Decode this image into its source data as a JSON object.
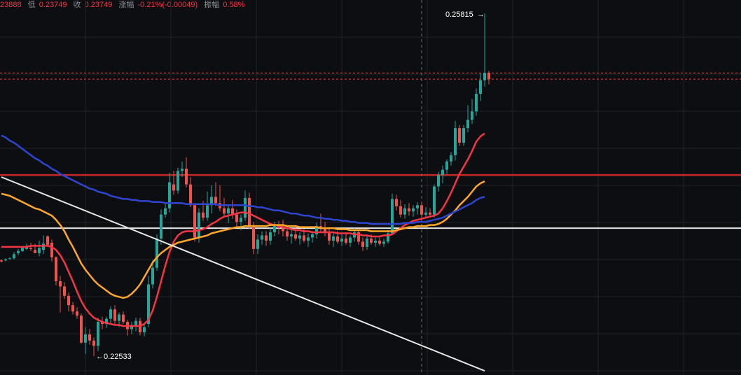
{
  "info_bar": {
    "high_value_fragment": "23888",
    "low_label": "低",
    "low_value": "0.23749",
    "close_label": "收",
    "close_value": "0.23749",
    "change_label": "涨幅",
    "change_value": "-0.21%(-0.00049)",
    "amplitude_label": "振幅",
    "amplitude_value": "0.58%"
  },
  "colors": {
    "background": "#0d0e11",
    "grid": "#1f2126",
    "up": "#26a69a",
    "down": "#ef5350",
    "ma_short": "#f23645",
    "ma_mid": "#ffa726",
    "ma_long": "#2f45d0",
    "horizontal_red": "#c62828",
    "trend_white": "#e6e6e6",
    "price_dash": "#ef5350",
    "crosshair": "#6b7078",
    "info_red": "#f23645"
  },
  "chart_data": {
    "type": "candlestick",
    "title": "",
    "ylim": [
      0.2235,
      0.2595
    ],
    "annotations": {
      "high_label": "0.25815",
      "high_value": 0.25815,
      "low_label": "0.22533",
      "low_value": 0.22533
    },
    "horizontal_lines": [
      {
        "name": "resistance",
        "value": 0.2427,
        "color": "red"
      },
      {
        "name": "support",
        "value": 0.2376,
        "color": "white"
      }
    ],
    "trend_line": {
      "from": {
        "index": 0,
        "value": 0.2425
      },
      "to": {
        "index": 115,
        "value": 0.2239
      }
    },
    "price_lines": [
      0.2525,
      0.2519
    ],
    "crosshair_index": 100,
    "candles": [
      [
        0.2345,
        0.2346,
        0.2343,
        0.2344
      ],
      [
        0.2345,
        0.2347,
        0.2344,
        0.2346
      ],
      [
        0.2347,
        0.2348,
        0.2346,
        0.2347
      ],
      [
        0.2347,
        0.2353,
        0.2346,
        0.2351
      ],
      [
        0.2352,
        0.2356,
        0.235,
        0.2354
      ],
      [
        0.2354,
        0.2358,
        0.2353,
        0.2357
      ],
      [
        0.2356,
        0.2361,
        0.2355,
        0.2359
      ],
      [
        0.2357,
        0.2362,
        0.2354,
        0.2356
      ],
      [
        0.2355,
        0.2361,
        0.2352,
        0.2352
      ],
      [
        0.2352,
        0.2364,
        0.2349,
        0.2357
      ],
      [
        0.2355,
        0.2369,
        0.2351,
        0.2361
      ],
      [
        0.2368,
        0.2369,
        0.2359,
        0.236
      ],
      [
        0.2362,
        0.2365,
        0.2344,
        0.2348
      ],
      [
        0.2348,
        0.2349,
        0.2321,
        0.2325
      ],
      [
        0.2325,
        0.233,
        0.2295,
        0.232
      ],
      [
        0.232,
        0.2324,
        0.2308,
        0.2311
      ],
      [
        0.2311,
        0.2314,
        0.2296,
        0.2302
      ],
      [
        0.2302,
        0.2305,
        0.2293,
        0.2296
      ],
      [
        0.2296,
        0.23,
        0.2289,
        0.2292
      ],
      [
        0.2292,
        0.2294,
        0.2265,
        0.2266
      ],
      [
        0.2266,
        0.2281,
        0.2255,
        0.2274
      ],
      [
        0.2274,
        0.2279,
        0.2264,
        0.2268
      ],
      [
        0.2268,
        0.2271,
        0.2253,
        0.2263
      ],
      [
        0.2263,
        0.229,
        0.2258,
        0.2286
      ],
      [
        0.2286,
        0.2291,
        0.2279,
        0.2284
      ],
      [
        0.2284,
        0.2291,
        0.228,
        0.2289
      ],
      [
        0.2289,
        0.2301,
        0.2285,
        0.2298
      ],
      [
        0.2298,
        0.2302,
        0.2284,
        0.2287
      ],
      [
        0.2287,
        0.2295,
        0.2281,
        0.2293
      ],
      [
        0.2293,
        0.2296,
        0.2284,
        0.2286
      ],
      [
        0.2286,
        0.2288,
        0.2273,
        0.2279
      ],
      [
        0.2279,
        0.2286,
        0.2274,
        0.2283
      ],
      [
        0.2283,
        0.229,
        0.2277,
        0.2287
      ],
      [
        0.2287,
        0.229,
        0.2273,
        0.2276
      ],
      [
        0.2276,
        0.2284,
        0.2272,
        0.2281
      ],
      [
        0.2284,
        0.233,
        0.2281,
        0.2322
      ],
      [
        0.2322,
        0.2345,
        0.2318,
        0.2338
      ],
      [
        0.2338,
        0.237,
        0.2335,
        0.2366
      ],
      [
        0.2366,
        0.2394,
        0.236,
        0.2389
      ],
      [
        0.2389,
        0.2401,
        0.2386,
        0.2395
      ],
      [
        0.2395,
        0.2429,
        0.2391,
        0.242
      ],
      [
        0.2418,
        0.2431,
        0.2408,
        0.2412
      ],
      [
        0.2412,
        0.2434,
        0.2409,
        0.2431
      ],
      [
        0.2431,
        0.244,
        0.2425,
        0.2433
      ],
      [
        0.2433,
        0.2444,
        0.2415,
        0.2418
      ],
      [
        0.2418,
        0.2425,
        0.2396,
        0.2398
      ],
      [
        0.2398,
        0.24,
        0.2363,
        0.2367
      ],
      [
        0.2367,
        0.2395,
        0.2362,
        0.2391
      ],
      [
        0.2391,
        0.2402,
        0.2383,
        0.2386
      ],
      [
        0.2386,
        0.2411,
        0.2383,
        0.2398
      ],
      [
        0.2398,
        0.2417,
        0.239,
        0.2406
      ],
      [
        0.2406,
        0.242,
        0.2397,
        0.24
      ],
      [
        0.24,
        0.2417,
        0.2392,
        0.2395
      ],
      [
        0.2395,
        0.2405,
        0.2387,
        0.239
      ],
      [
        0.239,
        0.2399,
        0.2381,
        0.2395
      ],
      [
        0.2395,
        0.2403,
        0.2385,
        0.2389
      ],
      [
        0.2389,
        0.2394,
        0.2378,
        0.2382
      ],
      [
        0.2382,
        0.2389,
        0.2374,
        0.2386
      ],
      [
        0.2386,
        0.2412,
        0.2383,
        0.2405
      ],
      [
        0.2405,
        0.241,
        0.2375,
        0.2378
      ],
      [
        0.2378,
        0.2382,
        0.2351,
        0.2356
      ],
      [
        0.2356,
        0.237,
        0.2351,
        0.2365
      ],
      [
        0.2365,
        0.2373,
        0.236,
        0.2369
      ],
      [
        0.2369,
        0.2373,
        0.2359,
        0.2364
      ],
      [
        0.2364,
        0.2376,
        0.236,
        0.2372
      ],
      [
        0.2372,
        0.2382,
        0.2368,
        0.2378
      ],
      [
        0.2378,
        0.2383,
        0.237,
        0.2376
      ],
      [
        0.2376,
        0.2384,
        0.2368,
        0.2373
      ],
      [
        0.2373,
        0.2379,
        0.2364,
        0.2368
      ],
      [
        0.2368,
        0.2374,
        0.2361,
        0.237
      ],
      [
        0.237,
        0.2376,
        0.2364,
        0.2366
      ],
      [
        0.2366,
        0.2372,
        0.236,
        0.2369
      ],
      [
        0.2369,
        0.2375,
        0.2362,
        0.2364
      ],
      [
        0.2364,
        0.2371,
        0.2358,
        0.2367
      ],
      [
        0.2367,
        0.2373,
        0.2362,
        0.237
      ],
      [
        0.237,
        0.2381,
        0.2366,
        0.2378
      ],
      [
        0.2378,
        0.239,
        0.2372,
        0.2376
      ],
      [
        0.2376,
        0.2382,
        0.2368,
        0.2372
      ],
      [
        0.2372,
        0.2377,
        0.236,
        0.2364
      ],
      [
        0.2364,
        0.2371,
        0.2358,
        0.2368
      ],
      [
        0.2368,
        0.2373,
        0.2361,
        0.2363
      ],
      [
        0.2363,
        0.237,
        0.2359,
        0.2366
      ],
      [
        0.2366,
        0.2372,
        0.236,
        0.2362
      ],
      [
        0.2362,
        0.2369,
        0.2358,
        0.2367
      ],
      [
        0.2367,
        0.2376,
        0.2363,
        0.2372
      ],
      [
        0.2372,
        0.2375,
        0.236,
        0.2363
      ],
      [
        0.2363,
        0.2367,
        0.2354,
        0.2358
      ],
      [
        0.2358,
        0.2368,
        0.2355,
        0.2366
      ],
      [
        0.2366,
        0.237,
        0.236,
        0.2362
      ],
      [
        0.2362,
        0.2367,
        0.2358,
        0.2364
      ],
      [
        0.2364,
        0.2367,
        0.2359,
        0.2361
      ],
      [
        0.2361,
        0.2366,
        0.2358,
        0.2363
      ],
      [
        0.2363,
        0.2374,
        0.2361,
        0.2371
      ],
      [
        0.2371,
        0.2409,
        0.2369,
        0.2404
      ],
      [
        0.2404,
        0.2408,
        0.2393,
        0.2397
      ],
      [
        0.2397,
        0.2403,
        0.2386,
        0.2389
      ],
      [
        0.2389,
        0.2399,
        0.2385,
        0.2395
      ],
      [
        0.2395,
        0.24,
        0.2388,
        0.2392
      ],
      [
        0.2392,
        0.2398,
        0.2387,
        0.2395
      ],
      [
        0.2395,
        0.2401,
        0.2389,
        0.2398
      ],
      [
        0.2398,
        0.2401,
        0.2386,
        0.2389
      ],
      [
        0.2389,
        0.2396,
        0.2386,
        0.2391
      ],
      [
        0.2391,
        0.2395,
        0.2386,
        0.2389
      ],
      [
        0.2389,
        0.2418,
        0.2386,
        0.2416
      ],
      [
        0.2416,
        0.243,
        0.2411,
        0.2427
      ],
      [
        0.2427,
        0.2436,
        0.2419,
        0.2432
      ],
      [
        0.2432,
        0.2442,
        0.2428,
        0.244
      ],
      [
        0.244,
        0.2449,
        0.2436,
        0.2446
      ],
      [
        0.2446,
        0.2479,
        0.2441,
        0.2472
      ],
      [
        0.2472,
        0.2475,
        0.2455,
        0.2458
      ],
      [
        0.2458,
        0.2475,
        0.2455,
        0.2472
      ],
      [
        0.2472,
        0.2494,
        0.2468,
        0.248
      ],
      [
        0.248,
        0.25,
        0.2476,
        0.2488
      ],
      [
        0.2488,
        0.251,
        0.2484,
        0.2505
      ],
      [
        0.2505,
        0.2525,
        0.2498,
        0.2518
      ],
      [
        0.2518,
        0.2582,
        0.2512,
        0.2525
      ],
      [
        0.2525,
        0.2527,
        0.2514,
        0.2519
      ]
    ],
    "moving_averages": [
      {
        "name": "",
        "color": "ma_short",
        "values": [
          0.2358,
          0.2358,
          0.2358,
          0.2358,
          0.2358,
          0.2358,
          0.2358,
          0.2359,
          0.2359,
          0.2359,
          0.2359,
          0.2359,
          0.2358,
          0.2355,
          0.235,
          0.2343,
          0.2334,
          0.2325,
          0.2315,
          0.2306,
          0.2299,
          0.2294,
          0.229,
          0.2288,
          0.2286,
          0.2285,
          0.2284,
          0.2283,
          0.2283,
          0.2282,
          0.2282,
          0.2282,
          0.2282,
          0.2282,
          0.2284,
          0.2288,
          0.2297,
          0.231,
          0.2325,
          0.234,
          0.2353,
          0.2363,
          0.2369,
          0.2372,
          0.2373,
          0.2373,
          0.2373,
          0.2374,
          0.2375,
          0.2377,
          0.238,
          0.2382,
          0.2385,
          0.2387,
          0.2388,
          0.2389,
          0.239,
          0.2391,
          0.2391,
          0.239,
          0.2388,
          0.2386,
          0.2384,
          0.2382,
          0.238,
          0.2379,
          0.2378,
          0.2377,
          0.2376,
          0.2375,
          0.2374,
          0.2374,
          0.2373,
          0.2373,
          0.2372,
          0.2372,
          0.2372,
          0.2372,
          0.2372,
          0.2372,
          0.2371,
          0.2371,
          0.2371,
          0.2371,
          0.237,
          0.237,
          0.2369,
          0.2369,
          0.2368,
          0.2368,
          0.2368,
          0.2369,
          0.2369,
          0.237,
          0.2373,
          0.2376,
          0.2379,
          0.2381,
          0.2383,
          0.2384,
          0.2385,
          0.2386,
          0.2387,
          0.2388,
          0.239,
          0.2395,
          0.2402,
          0.241,
          0.2419,
          0.2428,
          0.2435,
          0.2442,
          0.245,
          0.2459,
          0.2464,
          0.2467
        ]
      },
      {
        "name": "",
        "color": "ma_mid",
        "values": [
          0.2409,
          0.2408,
          0.2407,
          0.2405,
          0.2403,
          0.2401,
          0.2399,
          0.2397,
          0.2395,
          0.2394,
          0.2392,
          0.239,
          0.2388,
          0.2384,
          0.2379,
          0.2373,
          0.2365,
          0.2358,
          0.235,
          0.2342,
          0.2336,
          0.2331,
          0.2326,
          0.2322,
          0.2319,
          0.2316,
          0.2313,
          0.2311,
          0.231,
          0.2309,
          0.231,
          0.2313,
          0.2317,
          0.2322,
          0.2329,
          0.2336,
          0.2343,
          0.2348,
          0.2352,
          0.2355,
          0.2358,
          0.236,
          0.2362,
          0.2363,
          0.2364,
          0.2365,
          0.2366,
          0.2367,
          0.2368,
          0.2369,
          0.2371,
          0.2372,
          0.2373,
          0.2374,
          0.2375,
          0.2376,
          0.2377,
          0.2377,
          0.2378,
          0.2378,
          0.2378,
          0.2378,
          0.2378,
          0.2378,
          0.2379,
          0.2379,
          0.2379,
          0.2379,
          0.2378,
          0.2378,
          0.2378,
          0.2377,
          0.2377,
          0.2377,
          0.2377,
          0.2377,
          0.2376,
          0.2376,
          0.2376,
          0.2376,
          0.2375,
          0.2375,
          0.2375,
          0.2374,
          0.2374,
          0.2374,
          0.2374,
          0.2374,
          0.2373,
          0.2373,
          0.2373,
          0.2373,
          0.2373,
          0.2373,
          0.2374,
          0.2375,
          0.2376,
          0.2377,
          0.2377,
          0.2378,
          0.2378,
          0.2378,
          0.2379,
          0.2379,
          0.238,
          0.2382,
          0.2385,
          0.2389,
          0.2393,
          0.2398,
          0.2402,
          0.2406,
          0.2411,
          0.2416,
          0.2419,
          0.2421
        ]
      },
      {
        "name": "",
        "color": "ma_long",
        "values": [
          0.2465,
          0.2463,
          0.246,
          0.2458,
          0.2455,
          0.2452,
          0.2449,
          0.2446,
          0.2443,
          0.2441,
          0.2438,
          0.2436,
          0.2433,
          0.2431,
          0.2428,
          0.2426,
          0.2424,
          0.2422,
          0.242,
          0.2418,
          0.2416,
          0.2414,
          0.2413,
          0.2411,
          0.241,
          0.2409,
          0.2407,
          0.2406,
          0.2405,
          0.2404,
          0.2404,
          0.2403,
          0.2403,
          0.2402,
          0.2402,
          0.2402,
          0.2401,
          0.2401,
          0.2401,
          0.24,
          0.24,
          0.24,
          0.24,
          0.24,
          0.2399,
          0.2399,
          0.2399,
          0.2399,
          0.2399,
          0.2399,
          0.2399,
          0.2399,
          0.2398,
          0.2398,
          0.2398,
          0.2398,
          0.2398,
          0.2398,
          0.2398,
          0.2397,
          0.2397,
          0.2396,
          0.2396,
          0.2395,
          0.2394,
          0.2393,
          0.2393,
          0.2392,
          0.2391,
          0.239,
          0.239,
          0.2389,
          0.2388,
          0.2388,
          0.2387,
          0.2386,
          0.2386,
          0.2385,
          0.2385,
          0.2384,
          0.2384,
          0.2383,
          0.2383,
          0.2382,
          0.2382,
          0.2381,
          0.2381,
          0.2381,
          0.238,
          0.238,
          0.238,
          0.238,
          0.238,
          0.238,
          0.238,
          0.238,
          0.2381,
          0.2381,
          0.2381,
          0.2382,
          0.2382,
          0.2382,
          0.2383,
          0.2384,
          0.2385,
          0.2386,
          0.2388,
          0.239,
          0.2392,
          0.2394,
          0.2396,
          0.2398,
          0.24,
          0.2403,
          0.2405,
          0.2406
        ]
      }
    ]
  }
}
